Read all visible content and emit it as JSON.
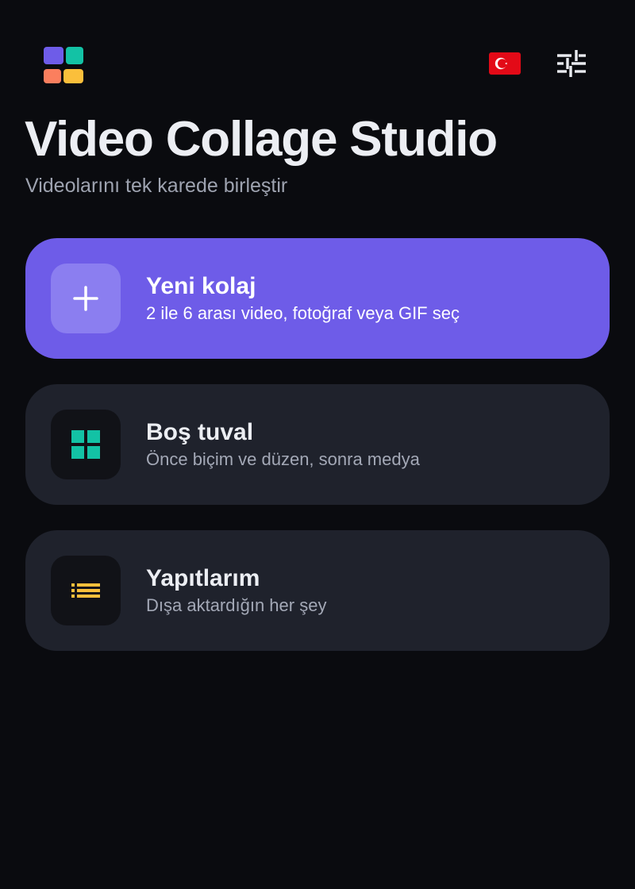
{
  "app": {
    "title": "Video Collage Studio",
    "subtitle": "Videolarını tek karede birleştir"
  },
  "header": {
    "logo_icon": "app-logo-grid",
    "language_flag": "turkey-flag-icon",
    "settings_icon": "sliders-icon"
  },
  "cards": [
    {
      "title": "Yeni kolaj",
      "subtitle": "2 ile 6 arası video, fotoğraf veya GIF seç",
      "icon": "plus-icon"
    },
    {
      "title": "Boş tuval",
      "subtitle": "Önce biçim ve düzen, sonra medya",
      "icon": "grid-icon"
    },
    {
      "title": "Yapıtlarım",
      "subtitle": "Dışa aktardığın her şey",
      "icon": "list-icon"
    }
  ],
  "colors": {
    "background": "#0a0b0f",
    "accent": "#6e5ce8",
    "card": "#1f222c",
    "teal": "#13c2a5",
    "amber": "#fbbf3b",
    "coral": "#fb7f5e"
  }
}
